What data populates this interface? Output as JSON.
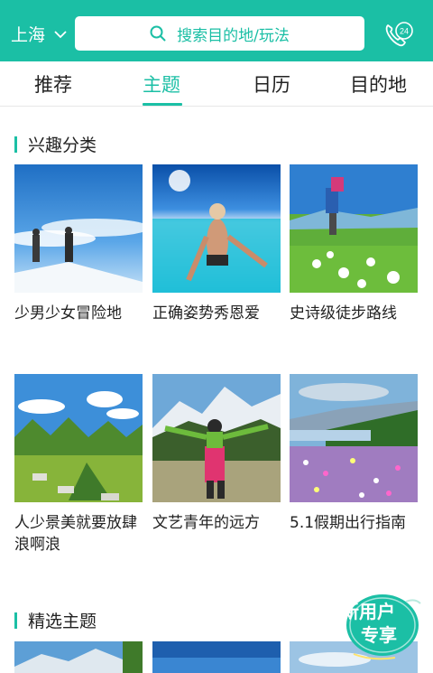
{
  "header": {
    "city": "上海",
    "search_placeholder": "搜索目的地/玩法",
    "phone_badge": "24",
    "icons": {
      "city_toggle": "chevron-down-icon",
      "search": "search-icon",
      "phone": "phone-24h-icon"
    },
    "accent_color": "#1bbfa5"
  },
  "tabs": [
    "推荐",
    "主题",
    "日历",
    "目的地"
  ],
  "active_tab": "主题",
  "interest_section": {
    "title": "兴趣分类",
    "cards": [
      {
        "title": "少男少女冒险地"
      },
      {
        "title": "正确姿势秀恩爱"
      },
      {
        "title": "史诗级徒步路线"
      },
      {
        "title": "人少景美就要放肆浪啊浪"
      },
      {
        "title": "文艺青年的远方"
      },
      {
        "title": "5.1假期出行指南"
      }
    ]
  },
  "featured_section": {
    "title": "精选主题"
  },
  "promo": {
    "line1": "新用户",
    "line2": "专享"
  }
}
